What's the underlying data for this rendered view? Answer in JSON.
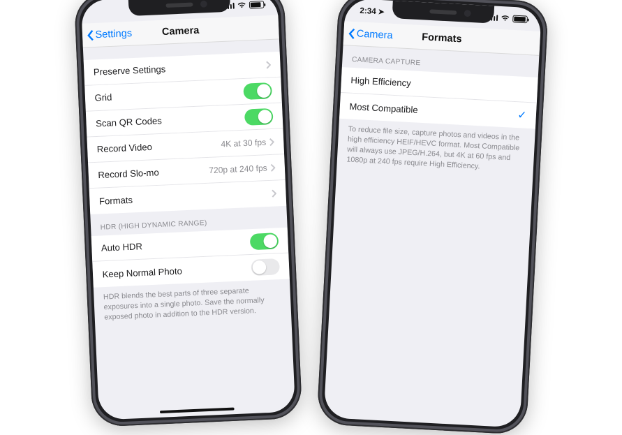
{
  "phoneA": {
    "status": {
      "time": ""
    },
    "nav": {
      "back": "Settings",
      "title": "Camera"
    },
    "rows": {
      "preserveSettings": "Preserve Settings",
      "grid": "Grid",
      "scanQR": "Scan QR Codes",
      "recordVideo": "Record Video",
      "recordVideoVal": "4K at 30 fps",
      "recordSlomo": "Record Slo-mo",
      "recordSlomoVal": "720p at 240 fps",
      "formats": "Formats"
    },
    "hdr": {
      "header": "HDR (HIGH DYNAMIC RANGE)",
      "autoHDR": "Auto HDR",
      "keepNormal": "Keep Normal Photo",
      "footnote": "HDR blends the best parts of three separate exposures into a single photo. Save the normally exposed photo in addition to the HDR version."
    }
  },
  "phoneB": {
    "status": {
      "time": "2:34"
    },
    "nav": {
      "back": "Camera",
      "title": "Formats"
    },
    "section": {
      "header": "CAMERA CAPTURE"
    },
    "rows": {
      "highEfficiency": "High Efficiency",
      "mostCompatible": "Most Compatible"
    },
    "footnote": "To reduce file size, capture photos and videos in the high efficiency HEIF/HEVC format. Most Compatible will always use JPEG/H.264, but 4K at 60 fps and 1080p at 240 fps require High Efficiency."
  }
}
